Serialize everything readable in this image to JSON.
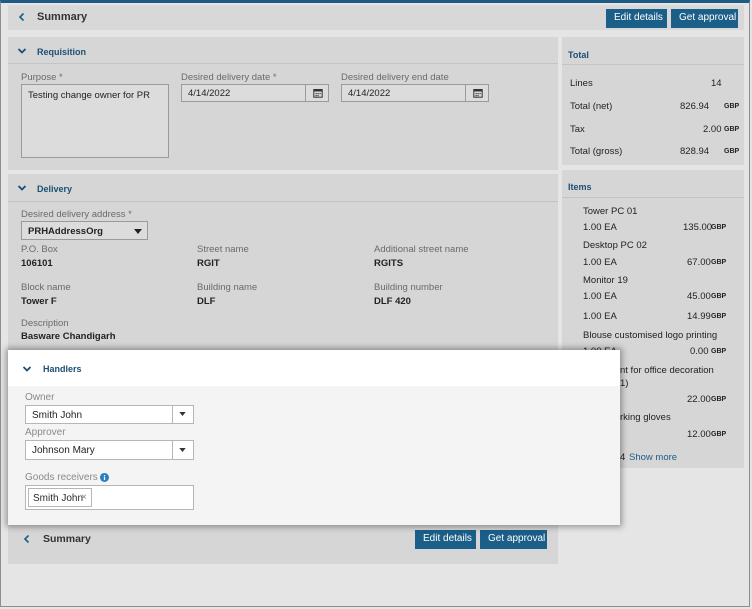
{
  "header": {
    "title": "Summary",
    "edit_label": "Edit details",
    "approve_label": "Get approval"
  },
  "requisition": {
    "section_title": "Requisition",
    "purpose_label": "Purpose *",
    "purpose_value": "Testing change owner for PR",
    "delivery_date_label": "Desired delivery date *",
    "delivery_date_value": "4/14/2022",
    "delivery_end_label": "Desired delivery end date",
    "delivery_end_value": "4/14/2022"
  },
  "delivery": {
    "section_title": "Delivery",
    "address_label": "Desired delivery address *",
    "address_value": "PRHAddressOrg",
    "fields": [
      {
        "label": "P.O. Box",
        "value": "106101"
      },
      {
        "label": "Street name",
        "value": "RGIT"
      },
      {
        "label": "Additional street name",
        "value": "RGITS"
      },
      {
        "label": "Block name",
        "value": "Tower F"
      },
      {
        "label": "Building name",
        "value": "DLF"
      },
      {
        "label": "Building number",
        "value": "DLF 420"
      },
      {
        "label": "Description",
        "value": "Basware Chandigarh"
      }
    ]
  },
  "total": {
    "section_title": "Total",
    "rows": [
      {
        "label": "Lines",
        "value": "14",
        "currency": ""
      },
      {
        "label": "Total (net)",
        "value": "826.94",
        "currency": "GBP"
      },
      {
        "label": "Tax",
        "value": "2.00",
        "currency": "GBP"
      },
      {
        "label": "Total (gross)",
        "value": "828.94",
        "currency": "GBP"
      }
    ]
  },
  "items": {
    "section_title": "Items",
    "list": [
      {
        "name": "Tower PC 01",
        "qty": "1.00 EA",
        "price": "135.00",
        "currency": "GBP"
      },
      {
        "name": "Desktop PC 02",
        "qty": "1.00 EA",
        "price": "67.00",
        "currency": "GBP"
      },
      {
        "name": "Monitor 19",
        "qty": "1.00 EA",
        "price": "45.00",
        "currency": "GBP"
      },
      {
        "name": "",
        "qty": "1.00 EA",
        "price": "14.99",
        "currency": "GBP"
      },
      {
        "name": "Blouse customised logo printing",
        "qty": "1.00 EA",
        "price": "0.00",
        "currency": "GBP"
      },
      {
        "name": "nt for office decoration",
        "qty": "1)",
        "price": "22.00",
        "currency": "GBP"
      },
      {
        "name": "rking gloves",
        "qty": "",
        "price": "12.00",
        "currency": "GBP"
      }
    ],
    "more_count": "4",
    "show_more": "Show more"
  },
  "handlers": {
    "section_title": "Handlers",
    "owner_label": "Owner",
    "owner_value": "Smith John",
    "approver_label": "Approver",
    "approver_value": "Johnson Mary",
    "receivers_label": "Goods receivers *",
    "receiver_tag": "Smith John"
  },
  "footer": {
    "title": "Summary",
    "edit_label": "Edit details",
    "approve_label": "Get approval"
  }
}
